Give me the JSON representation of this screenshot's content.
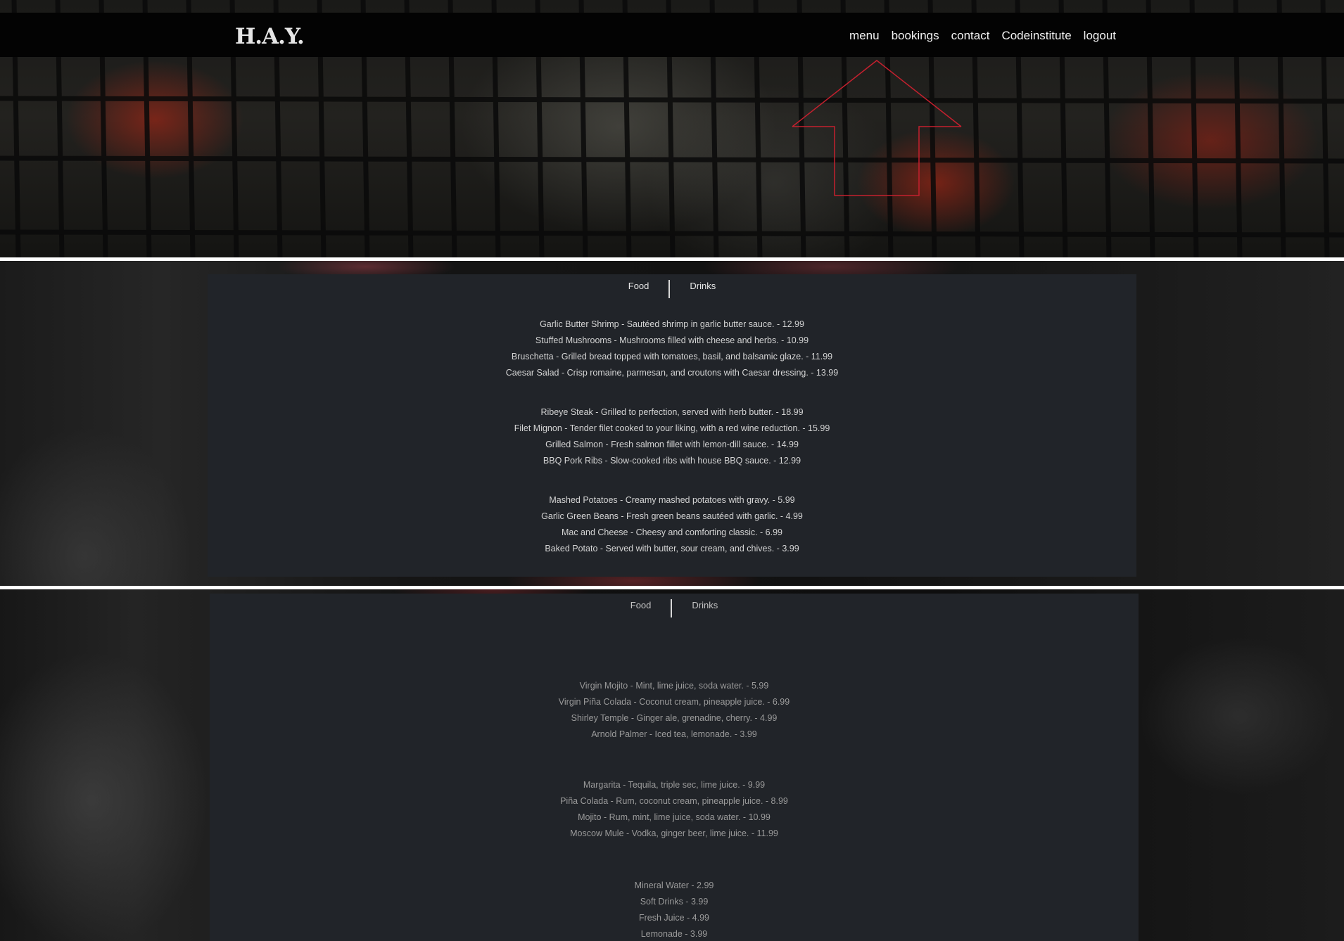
{
  "header": {
    "logo": "H.A.Y.",
    "nav": [
      "menu",
      "bookings",
      "contact",
      "Codeinstitute",
      "logout"
    ]
  },
  "food_menu": {
    "tabs": [
      "Food",
      "Drinks"
    ],
    "groups": [
      [
        "Garlic Butter Shrimp - Sautéed shrimp in garlic butter sauce. - 12.99",
        "Stuffed Mushrooms - Mushrooms filled with cheese and herbs. - 10.99",
        "Bruschetta - Grilled bread topped with tomatoes, basil, and balsamic glaze. - 11.99",
        "Caesar Salad - Crisp romaine, parmesan, and croutons with Caesar dressing. - 13.99"
      ],
      [
        "Ribeye Steak - Grilled to perfection, served with herb butter. - 18.99",
        "Filet Mignon - Tender filet cooked to your liking, with a red wine reduction. - 15.99",
        "Grilled Salmon - Fresh salmon fillet with lemon-dill sauce. - 14.99",
        "BBQ Pork Ribs - Slow-cooked ribs with house BBQ sauce. - 12.99"
      ],
      [
        "Mashed Potatoes - Creamy mashed potatoes with gravy. - 5.99",
        "Garlic Green Beans - Fresh green beans sautéed with garlic. - 4.99",
        "Mac and Cheese - Cheesy and comforting classic. - 6.99",
        "Baked Potato - Served with butter, sour cream, and chives. - 3.99"
      ]
    ]
  },
  "drinks_menu": {
    "tabs": [
      "Food",
      "Drinks"
    ],
    "groups": [
      [
        "Virgin Mojito - Mint, lime juice, soda water. - 5.99",
        "Virgin Piña Colada - Coconut cream, pineapple juice. - 6.99",
        "Shirley Temple - Ginger ale, grenadine, cherry. - 4.99",
        "Arnold Palmer - Iced tea, lemonade. - 3.99"
      ],
      [
        "Margarita - Tequila, triple sec, lime juice. - 9.99",
        "Piña Colada - Rum, coconut cream, pineapple juice. - 8.99",
        "Mojito - Rum, mint, lime juice, soda water. - 10.99",
        "Moscow Mule - Vodka, ginger beer, lime juice. - 11.99"
      ],
      [
        "Mineral Water - 2.99",
        "Soft Drinks - 3.99",
        "Fresh Juice - 4.99",
        "Lemonade - 3.99"
      ]
    ]
  },
  "colors": {
    "panel": "#212429",
    "navbar": "#030303",
    "house_outline": "#c4202e"
  },
  "icons": [
    "grill-background",
    "house-outline-icon"
  ]
}
